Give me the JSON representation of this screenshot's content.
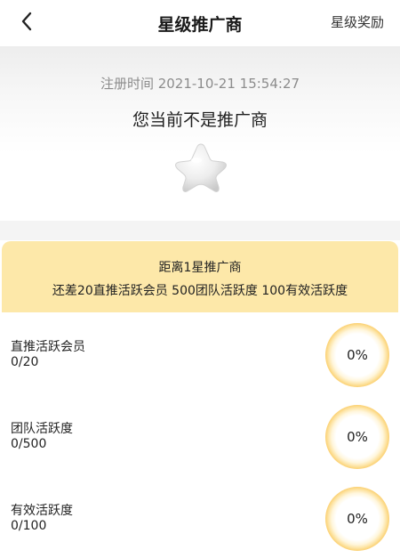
{
  "nav": {
    "title": "星级推广商",
    "right_label": "星级奖励",
    "back_icon": "chevron-left-icon"
  },
  "header": {
    "registration": "注册时间 2021-10-21 15:54:27",
    "status": "您当前不是推广商",
    "star_icon": "star-icon"
  },
  "target": {
    "title": "距离1星推广商",
    "description": "还差20直推活跃会员 500团队活跃度 100有效活跃度"
  },
  "metrics": [
    {
      "label": "直推活跃会员",
      "value": "0/20",
      "percent": "0%"
    },
    {
      "label": "团队活跃度",
      "value": "0/500",
      "percent": "0%"
    },
    {
      "label": "有效活跃度",
      "value": "0/100",
      "percent": "0%"
    }
  ],
  "colors": {
    "card_bg": "#fde8a9",
    "ring_accent": "#fbd071",
    "separator": "#f4f4f4"
  }
}
